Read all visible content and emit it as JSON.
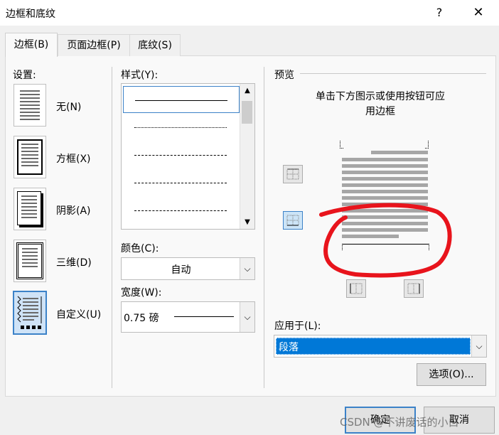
{
  "window": {
    "title": "边框和底纹",
    "help": "?",
    "close": "✕"
  },
  "tabs": [
    {
      "label": "边框(B)"
    },
    {
      "label": "页面边框(P)"
    },
    {
      "label": "底纹(S)"
    }
  ],
  "settings": {
    "heading": "设置:",
    "options": [
      {
        "label": "无(N)"
      },
      {
        "label": "方框(X)"
      },
      {
        "label": "阴影(A)"
      },
      {
        "label": "三维(D)"
      },
      {
        "label": "自定义(U)"
      }
    ]
  },
  "style": {
    "heading": "样式(Y):"
  },
  "color": {
    "heading": "颜色(C):",
    "value": "自动"
  },
  "width": {
    "heading": "宽度(W):",
    "value": "0.75 磅"
  },
  "preview": {
    "heading": "预览",
    "instruction_line1": "单击下方图示或使用按钮可应",
    "instruction_line2": "用边框"
  },
  "apply_to": {
    "heading": "应用于(L):",
    "value": "段落"
  },
  "options_button": "选项(O)...",
  "ok_button": "确定",
  "cancel_button": "取消",
  "watermark": "CSDN @不讲废话的小白",
  "colors": {
    "accent": "#3c82c8",
    "selection": "#0078d7",
    "annotation": "#e8141c"
  }
}
